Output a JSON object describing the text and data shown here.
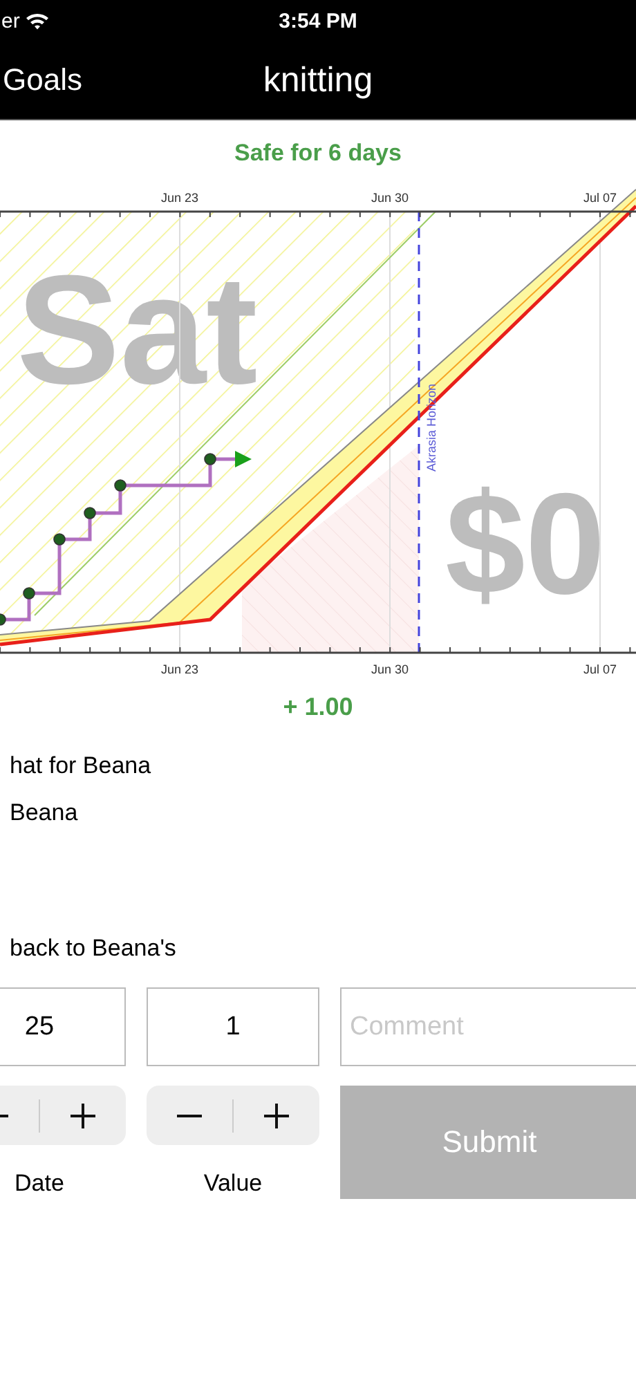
{
  "status_bar": {
    "carrier": "er",
    "time": "3:54 PM"
  },
  "nav_bar": {
    "back": "Goals",
    "title": "knitting"
  },
  "safety": "Safe for 6 days",
  "graph": {
    "top_ticks": [
      "Jun 23",
      "Jun 30",
      "Jul 07"
    ],
    "bottom_ticks": [
      "Jun 23",
      "Jun 30",
      "Jul 07"
    ],
    "watermark_left": "Sat",
    "watermark_right": "$0",
    "horizon_label": "Akrasia Horizon"
  },
  "delta": "+ 1.00",
  "lines": [
    "hat for Beana",
    "Beana",
    "back to Beana's"
  ],
  "form": {
    "date": {
      "value": "25",
      "label": "Date"
    },
    "value": {
      "value": "1",
      "label": "Value"
    },
    "comment": {
      "placeholder": "Comment"
    },
    "submit": "Submit"
  }
}
